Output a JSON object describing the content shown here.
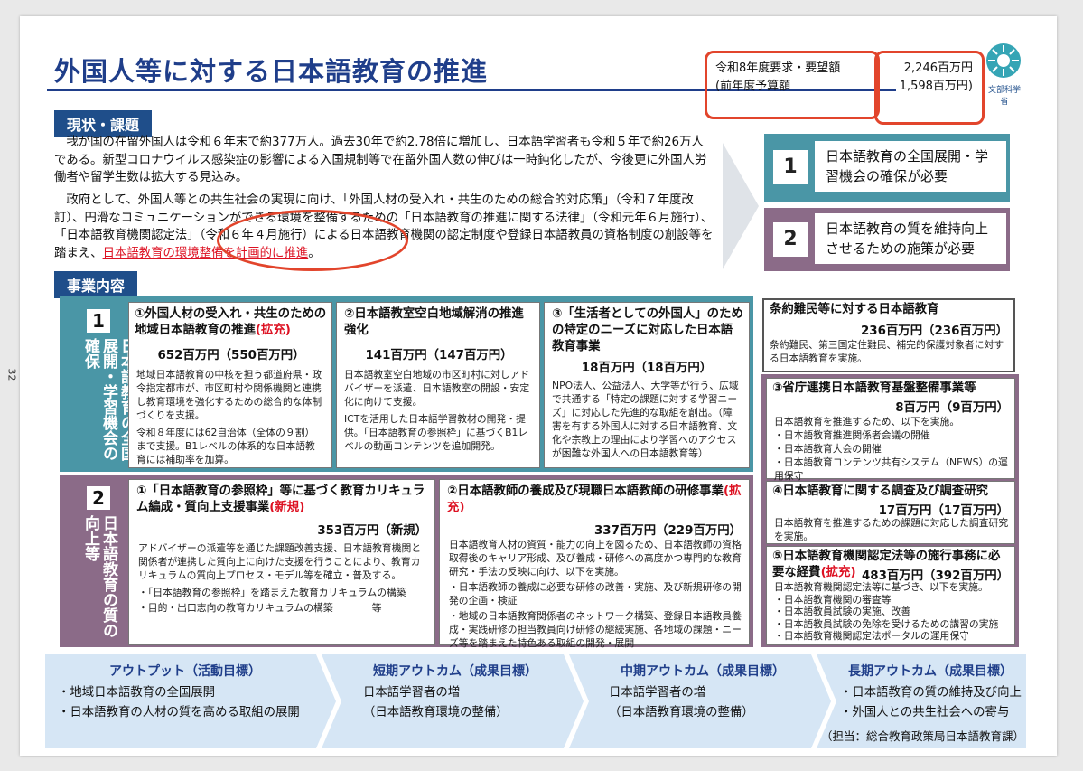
{
  "title": "外国人等に対する日本語教育の推進",
  "budget": {
    "request_label": "令和8年度要求・要望額",
    "request_value": "2,246百万円",
    "prior_label": "(前年度予算額",
    "prior_value": "1,598百万円)"
  },
  "logo_text": "文部科学省",
  "page_number": "32",
  "status": {
    "heading": "現状・課題",
    "para1": "我が国の在留外国人は令和６年末で約377万人。過去30年で約2.78倍に増加し、日本語学習者も令和５年で約26万人である。新型コロナウイルス感染症の影響による入国規制等で在留外国人数の伸びは一時鈍化したが、今後更に外国人労働者や留学生数は拡大する見込み。",
    "para2_a": "政府として、外国人等との共生社会の実現に向け、「外国人材の受入れ・共生のための総合的対応策」（令和７年度改訂）、円滑なコミュニケーションができる環境を整備するための「日本語教育の推進に関する法律」（令和元年６月施行）、「日本語教育機関認定法」（令和６年４月施行）による日本語教育機関の認定制度や登録日本語教員の資格制度の創設等を踏まえ、",
    "para2_b": "日本語教育の環境整備を計画的に推進",
    "para2_c": "。"
  },
  "issues": [
    {
      "num": "1",
      "text": "日本語教育の全国展開・学習機会の確保が必要"
    },
    {
      "num": "2",
      "text": "日本語教育の質を維持向上させるための施策が必要"
    }
  ],
  "projects_heading": "事業内容",
  "band1": {
    "num": "1",
    "label": "日本語教育の全国展開・学習機会の確保"
  },
  "band2": {
    "num": "2",
    "label": "日本語教育の質の向上等"
  },
  "cards_row1": [
    {
      "title_a": "①外国人材の受入れ・共生のための地域日本語教育の推進",
      "title_tag": "(拡充)",
      "amount": "652百万円（550百万円）",
      "body": [
        "地域日本語教育の中核を担う都道府県・政令指定都市が、市区町村や関係機関と連携し教育環境を強化するための総合的な体制づくりを支援。",
        "令和８年度には62自治体（全体の９割）まで支援。B1レベルの体系的な日本語教育には補助率を加算。"
      ]
    },
    {
      "title_a": "②日本語教室空白地域解消の推進強化",
      "title_tag": "",
      "amount": "141百万円（147百万円）",
      "body": [
        "日本語教室空白地域の市区町村に対しアドバイザーを派遣、日本語教室の開設・安定化に向けて支援。",
        "ICTを活用した日本語学習教材の開発・提供。「日本語教育の参照枠」に基づくB1レベルの動画コンテンツを追加開発。"
      ]
    },
    {
      "title_a": "③「生活者としての外国人」のための特定のニーズに対応した日本語教育事業",
      "title_tag": "",
      "amount": "18百万円（18百万円）",
      "body": [
        "NPO法人、公益法人、大学等が行う、広域で共通する「特定の課題に対する学習ニーズ」に対応した先進的な取組を創出。（障害を有する外国人に対する日本語教育、文化や宗教上の理由により学習へのアクセスが困難な外国人への日本語教育等）"
      ]
    }
  ],
  "cards_row2": [
    {
      "title_a": "①「日本語教育の参照枠」等に基づく教育カリキュラム編成・質向上支援事業",
      "title_tag": "(新規)",
      "amount": "353百万円（新規）",
      "body": [
        "アドバイザーの派遣等を通じた課題改善支援、日本語教育機関と関係者が連携した質向上に向けた支援を行うことにより、教育カリキュラムの質向上プロセス・モデル等を確立・普及する。",
        "・「日本語教育の参照枠」を踏まえた教育カリキュラムの構築",
        "・目的・出口志向の教育カリキュラムの構築　　　　等"
      ]
    },
    {
      "title_a": "②日本語教師の養成及び現職日本語教師の研修事業",
      "title_tag": "(拡充)",
      "amount": "337百万円（229百万円）",
      "body": [
        "日本語教育人材の資質・能力の向上を図るため、日本語教師の資格取得後のキャリア形成、及び養成・研修への高度かつ専門的な教育研究・手法の反映に向け、以下を実施。",
        "・日本語教師の養成に必要な研修の改善・実施、及び新規研修の開発の企画・検証",
        "・地域の日本語教育関係者のネットワーク構築、登録日本語教員養成・実践研修の担当教員向け研修の継続実施、各地域の課題・ニーズ等を踏まえた特色ある取組の開発・展開"
      ]
    }
  ],
  "side_cards": [
    {
      "title": "条約難民等に対する日本語教育",
      "amount": "236百万円（236百万円）",
      "body": [
        "条約難民、第三国定住難民、補完的保護対象者に対する日本語教育を実施。"
      ]
    },
    {
      "title": "③省庁連携日本語教育基盤整備事業等",
      "amount": "8百万円（9百万円）",
      "body": [
        "日本語教育を推進するため、以下を実施。",
        "・日本語教育推進関係者会議の開催",
        "・日本語教育大会の開催",
        "・日本語教育コンテンツ共有システム（NEWS）の運用保守"
      ]
    },
    {
      "title": "④日本語教育に関する調査及び調査研究",
      "amount": "17百万円（17百万円）",
      "body": [
        "日本語教育を推進するための課題に対応した調査研究を実施。"
      ]
    },
    {
      "title_a": "⑤日本語教育機関認定法等の施行事務に必要な経費",
      "title_tag": "(拡充)",
      "amount": "483百万円（392百万円）",
      "body": [
        "日本語教育機関認定法等に基づき、以下を実施。",
        "・日本語教育機関の審査等",
        "・日本語教員試験の実施、改善",
        "・日本語教員試験の免除を受けるための講習の実施",
        "・日本語教育機関認定法ポータルの運用保守"
      ]
    }
  ],
  "outcomes": [
    {
      "head": "アウトプット（活動目標）",
      "lines": [
        "・地域日本語教育の全国展開",
        "・日本語教育の人材の質を高める取組の展開"
      ]
    },
    {
      "head": "短期アウトカム（成果目標）",
      "lines": [
        "日本語学習者の増",
        "（日本語教育環境の整備）"
      ]
    },
    {
      "head": "中期アウトカム（成果目標）",
      "lines": [
        "日本語学習者の増",
        "（日本語教育環境の整備）"
      ]
    },
    {
      "head": "長期アウトカム（成果目標）",
      "lines": [
        "・日本語教育の質の維持及び向上",
        "・外国人との共生社会への寄与"
      ]
    }
  ],
  "footer_note": "（担当：総合教育政策局日本語教育課）",
  "colors": {
    "navy": "#1f4e8a",
    "teal": "#4a96a6",
    "mauve": "#8b6b88",
    "red": "#e2452c"
  }
}
